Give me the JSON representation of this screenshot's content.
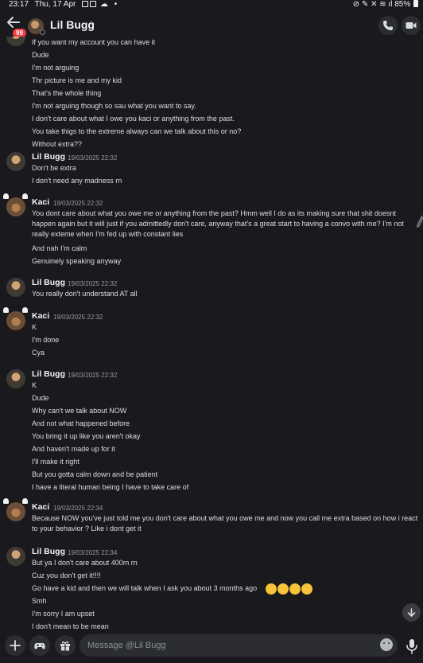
{
  "status_bar": {
    "time": "23:17",
    "date": "Thu, 17 Apr",
    "dot": "•",
    "battery": "85%"
  },
  "header": {
    "unread_badge": "99",
    "contact_name": "Lil Bugg",
    "chevron": "›",
    "icons": [
      "back-arrow-icon",
      "phone-call-icon",
      "video-call-icon"
    ]
  },
  "messages": [
    {
      "author": "",
      "timestamp": "",
      "lines": [
        "If you want my account you can have it",
        "Dude",
        "I'm not arguing",
        "Thr picture is me and my kid",
        "That's the whole thing",
        "I'm not arguing though so sau what you want to say.",
        "I don't care about what I owe you kaci or anything from the past.",
        "You take thigs to the extreme always can we talk about this or no?",
        "Without extra??"
      ]
    },
    {
      "author": "Lil Bugg",
      "timestamp": "19/03/2025 22:32",
      "lines": [
        "Don't be extra",
        "I don't need any madness rn"
      ]
    },
    {
      "author": "Kaci",
      "timestamp": "19/03/2025 22:32",
      "lines": [
        "You dont care about what you owe me or anything from the past? Hmm well I do  as its making sure that shit doesnt happen again but it will just if you admittedly don't care, anyway that's a great start to having a convo with me? I'm not really exteme when I'm fed up with constant lies",
        "And nah I'm calm",
        "Genuinely speaking anyway"
      ]
    },
    {
      "author": "Lil Bugg",
      "timestamp": "19/03/2025 22:32",
      "lines": [
        "You really don't understand AT all"
      ]
    },
    {
      "author": "Kaci",
      "timestamp": "19/03/2025 22:32",
      "lines": [
        "K",
        "I'm done",
        "Cya"
      ]
    },
    {
      "author": "Lil Bugg",
      "timestamp": "19/03/2025 22:32",
      "lines": [
        "K",
        "Dude",
        "Why can't we talk about NOW",
        "And not what happened before",
        "You bring it up like you aren't okay",
        "And haven't made up for it",
        "I'll make it right",
        "But you gotta calm down and be patient",
        "I have a literal human being I have to take care of"
      ]
    },
    {
      "author": "Kaci",
      "timestamp": "19/03/2025 22:34",
      "lines": [
        "Because NOW you've just told me you don't care about what you owe me and now you call me extra based on how i react to your behavior ? Like i dont get it"
      ]
    },
    {
      "author": "Lil Bugg",
      "timestamp": "19/03/2025 22:34",
      "lines": [
        "But ya I don't care about 400m rn",
        "Cuz you don't get it!!!!",
        "Go have a kid and then we will talk when I ask you about 3 months ago",
        "Smh",
        "I'm sorry I am upset",
        "I don't mean to be mean"
      ]
    }
  ],
  "composer": {
    "placeholder": "Message @Lil Bugg",
    "icons": [
      "plus-icon",
      "gamepad-icon",
      "gift-icon",
      "emoji-icon",
      "microphone-icon"
    ]
  },
  "colors": {
    "background": "#1a1a1e",
    "text": "#dbdee1",
    "username": "#f2f3f5",
    "timestamp": "#949ba4",
    "badge": "#f23f43"
  }
}
